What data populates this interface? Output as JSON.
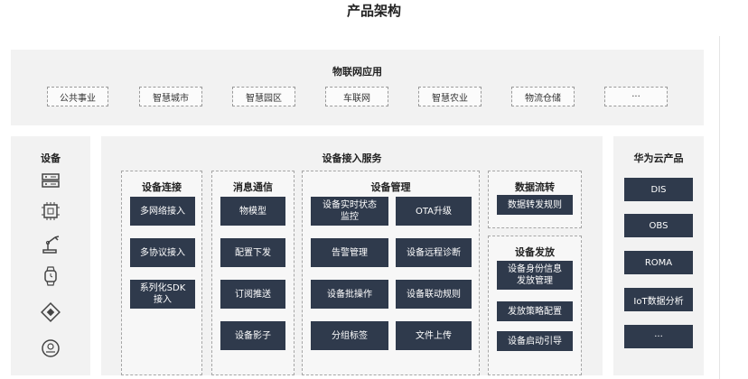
{
  "title": "产品架构",
  "apps": {
    "title": "物联网应用",
    "items": [
      "公共事业",
      "智慧城市",
      "智慧园区",
      "车联网",
      "智慧农业",
      "物流仓储",
      "···"
    ]
  },
  "devices": {
    "title": "设备",
    "icons": [
      "server-icon",
      "chip-icon",
      "robot-arm-icon",
      "smartwatch-icon",
      "processor-icon",
      "robot-vacuum-icon"
    ]
  },
  "access": {
    "title": "设备接入服务",
    "connect": {
      "title": "设备连接",
      "items": [
        "多网络接入",
        "多协议接入",
        "系列化SDK\n接入"
      ]
    },
    "messaging": {
      "title": "消息通信",
      "items": [
        "物模型",
        "配置下发",
        "订阅推送",
        "设备影子"
      ]
    },
    "management": {
      "title": "设备管理",
      "items": [
        "设备实时状态\n监控",
        "OTA升级",
        "告警管理",
        "设备远程诊断",
        "设备批操作",
        "设备联动规则",
        "分组标签",
        "文件上传"
      ]
    },
    "flow": {
      "title": "数据流转",
      "items": [
        "数据转发规则"
      ]
    },
    "provision": {
      "title": "设备发放",
      "items": [
        "设备身份信息\n发放管理",
        "发放策略配置",
        "设备启动引导"
      ]
    }
  },
  "cloud": {
    "title": "华为云产品",
    "items": [
      "DIS",
      "OBS",
      "ROMA",
      "IoT数据分析",
      "···"
    ]
  },
  "colors": {
    "button": "#2f3a4c",
    "panel": "#f2f2f2"
  }
}
